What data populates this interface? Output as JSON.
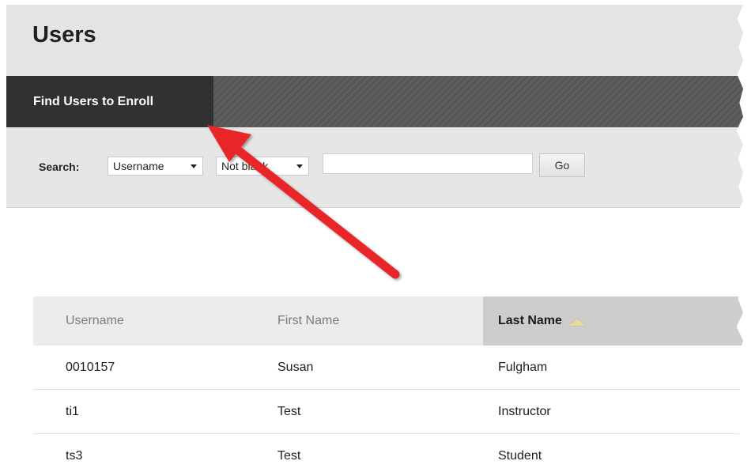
{
  "page": {
    "title": "Users"
  },
  "tabs": [
    {
      "label": "Find Users to Enroll",
      "active": true
    }
  ],
  "search": {
    "label": "Search:",
    "field_select": {
      "selected": "Username"
    },
    "operator_select": {
      "selected": "Not blank"
    },
    "input": {
      "value": "",
      "placeholder": ""
    },
    "go_label": "Go"
  },
  "table": {
    "columns": [
      {
        "label": "Username"
      },
      {
        "label": "First Name"
      },
      {
        "label": "Last Name",
        "sorted": "ascending"
      }
    ],
    "rows": [
      {
        "username": "0010157",
        "first_name": "Susan",
        "last_name": "Fulgham"
      },
      {
        "username": "ti1",
        "first_name": "Test",
        "last_name": "Instructor"
      },
      {
        "username": "ts3",
        "first_name": "Test",
        "last_name": "Student"
      }
    ]
  },
  "icons": {
    "sort": "sort-ascending-icon",
    "callout": "red-arrow-icon"
  },
  "colors": {
    "tab_active": "#313131",
    "callout_arrow": "#e8262c",
    "sort_icon": "#e8d9a2"
  }
}
